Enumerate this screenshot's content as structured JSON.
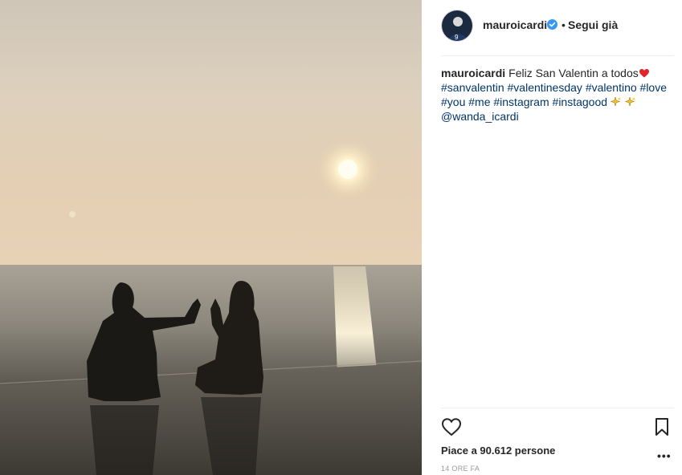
{
  "post": {
    "username": "mauroicardi",
    "follow_separator": "•",
    "follow_status": "Segui già",
    "caption_user": "mauroicardi",
    "caption_text": "Feliz San Valentin a todos",
    "hashtags": [
      "#sanvalentin",
      "#valentinesday",
      "#valentino",
      "#love",
      "#you",
      "#me",
      "#instagram",
      "#instagood"
    ],
    "mention": "@wanda_icardi",
    "likes_text": "Piace a 90.612 persone",
    "time_text": "14 ORE FA",
    "more_label": "•••"
  },
  "icons": {
    "verified": "verified-badge-icon",
    "heart": "heart-outline-icon",
    "bookmark": "bookmark-outline-icon",
    "caption_emoji_1": "red-heart-emoji",
    "caption_emoji_2": "sparkles-emoji"
  },
  "colors": {
    "link": "#003569",
    "verified": "#3897f0",
    "divider": "#efefef",
    "timestamp": "#999999"
  }
}
